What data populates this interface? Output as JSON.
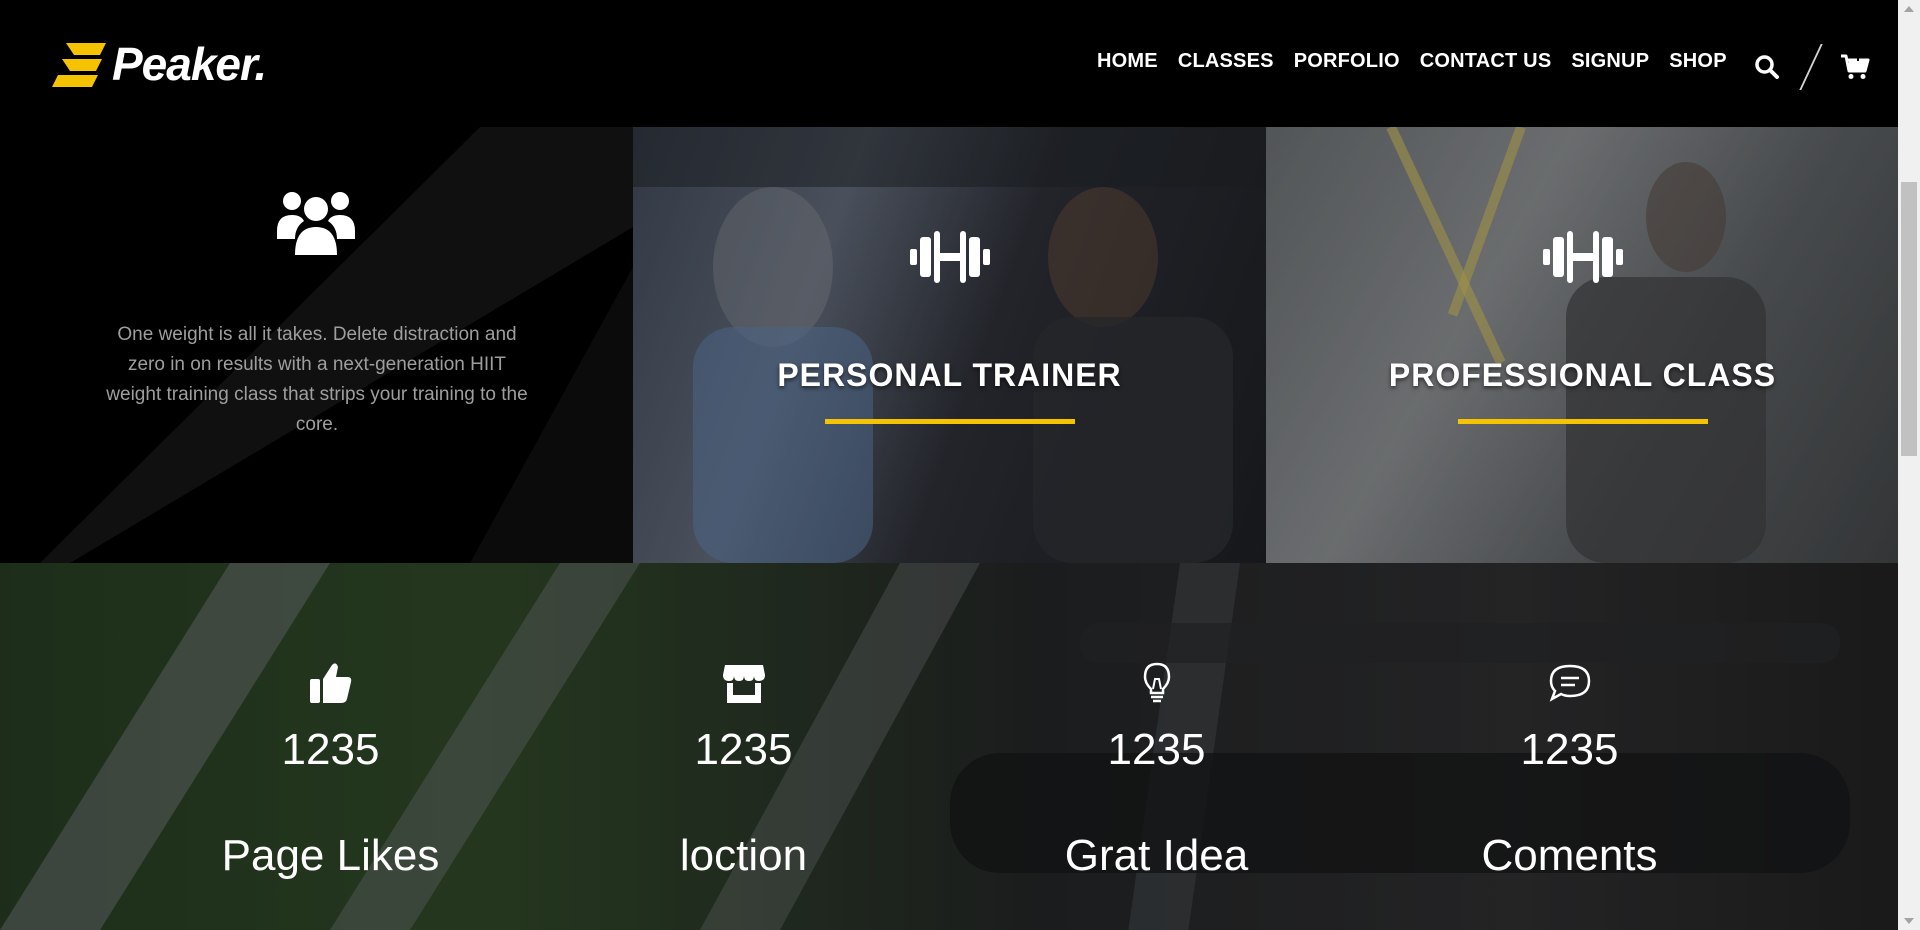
{
  "brand": {
    "name": "Peaker.",
    "accent": "#f6c300"
  },
  "nav": {
    "items": [
      {
        "label": "HOME"
      },
      {
        "label": "CLASSES"
      },
      {
        "label": "PORFOLIO"
      },
      {
        "label": "CONTACT US"
      },
      {
        "label": "SIGNUP"
      },
      {
        "label": "SHOP"
      }
    ],
    "icons": [
      "search-icon",
      "cart-icon"
    ]
  },
  "feature": {
    "icon": "users-icon",
    "text": "One weight is all it takes. Delete distraction and zero in on results with a next-generation HIIT weight training class that strips your training to the core."
  },
  "cards": [
    {
      "title": "PERSONAL TRAINER",
      "icon": "dumbbell-icon"
    },
    {
      "title": "PROFESSIONAL CLASS",
      "icon": "dumbbell-icon"
    }
  ],
  "stats": [
    {
      "icon": "thumbs-up-icon",
      "value": "1235",
      "label": "Page Likes"
    },
    {
      "icon": "store-icon",
      "value": "1235",
      "label": "loction"
    },
    {
      "icon": "lightbulb-icon",
      "value": "1235",
      "label": "Grat Idea"
    },
    {
      "icon": "comment-icon",
      "value": "1235",
      "label": "Coments"
    }
  ]
}
